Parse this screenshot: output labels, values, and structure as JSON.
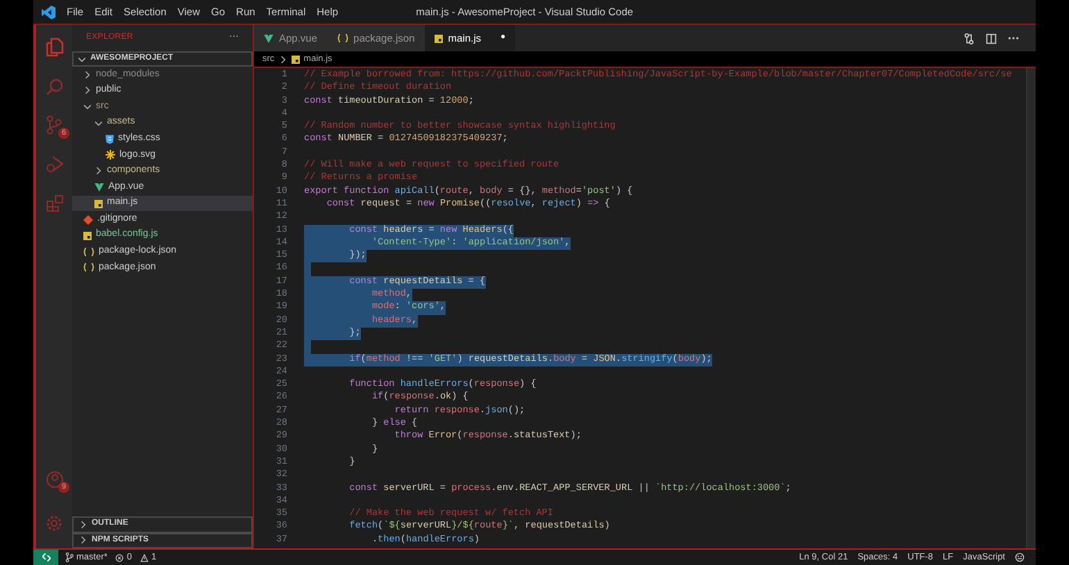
{
  "title_bar": {
    "menu": [
      "File",
      "Edit",
      "Selection",
      "View",
      "Go",
      "Run",
      "Terminal",
      "Help"
    ],
    "title": "main.js - AwesomeProject - Visual Studio Code"
  },
  "activity_bar": {
    "items": [
      {
        "kind": "explorer",
        "selected": true
      },
      {
        "kind": "search",
        "selected": false
      },
      {
        "kind": "source-control",
        "selected": false,
        "badge": "6"
      },
      {
        "kind": "run",
        "selected": false
      },
      {
        "kind": "extensions",
        "selected": false
      }
    ],
    "bottom": [
      {
        "kind": "account",
        "badge": "9"
      },
      {
        "kind": "settings"
      }
    ]
  },
  "sidebar": {
    "title": "EXPLORER",
    "more": "···",
    "project": "AWESOMEPROJECT",
    "tree": [
      {
        "label": "node_modules",
        "kind": "folder",
        "expanded": false,
        "selected": false,
        "color": "#8b8b8b"
      },
      {
        "label": "public",
        "kind": "folder",
        "expanded": false,
        "selected": false,
        "color": "#cccccc"
      },
      {
        "label": "src",
        "kind": "folder",
        "expanded": true,
        "selected": false,
        "color": "#a89a78",
        "children": [
          {
            "label": "assets",
            "kind": "folder",
            "expanded": true,
            "selected": false,
            "color": "#c9b98c",
            "children": [
              {
                "label": "styles.css",
                "kind": "css",
                "selected": false,
                "color": "#cccccc"
              },
              {
                "label": "logo.svg",
                "kind": "svg",
                "selected": false,
                "color": "#cccccc"
              }
            ]
          },
          {
            "label": "components",
            "kind": "folder",
            "expanded": false,
            "selected": false,
            "color": "#c9b98c"
          },
          {
            "label": "App.vue",
            "kind": "vue",
            "selected": false,
            "color": "#cccccc"
          },
          {
            "label": "main.js",
            "kind": "js",
            "selected": true,
            "color": "#cccccc"
          }
        ]
      },
      {
        "label": ".gitignore",
        "kind": "git",
        "selected": false,
        "color": "#cccccc"
      },
      {
        "label": "babel.config.js",
        "kind": "js",
        "selected": false,
        "color": "#73c991"
      },
      {
        "label": "package-lock.json",
        "kind": "json",
        "selected": false,
        "color": "#cccccc"
      },
      {
        "label": "package.json",
        "kind": "json",
        "selected": false,
        "color": "#cccccc"
      }
    ],
    "panels": [
      {
        "label": "OUTLINE",
        "expanded": false
      },
      {
        "label": "NPM SCRIPTS",
        "expanded": false
      }
    ]
  },
  "tabs": [
    {
      "label": "App.vue",
      "kind": "vue",
      "selected": false,
      "modified": false
    },
    {
      "label": "package.json",
      "kind": "json",
      "selected": false,
      "modified": false
    },
    {
      "label": "main.js",
      "kind": "js",
      "selected": true,
      "modified": true,
      "dot": "●"
    }
  ],
  "breadcrumb": [
    {
      "label": "src",
      "kind": "folder"
    },
    {
      "label": "main.js",
      "kind": "js"
    }
  ],
  "code": [
    {
      "number": "1",
      "selected": false,
      "tokens": [
        {
          "text": "// Example borrowed from: https://github.com/PacktPublishing/JavaScript-by-Example/blob/master/Chapter07/CompletedCode/src/se",
          "kind": "comment"
        }
      ]
    },
    {
      "number": "2",
      "selected": false,
      "tokens": [
        {
          "text": "// Define timeout duration",
          "kind": "comment"
        }
      ]
    },
    {
      "number": "3",
      "selected": false,
      "tokens": [
        {
          "text": "const ",
          "kind": "keyword"
        },
        {
          "text": "timeoutDuration",
          "kind": "name"
        },
        {
          "text": " = ",
          "kind": "punct"
        },
        {
          "text": "12000",
          "kind": "number"
        },
        {
          "text": ";",
          "kind": "punct"
        }
      ]
    },
    {
      "number": "4",
      "selected": false
    },
    {
      "number": "5",
      "selected": false,
      "tokens": [
        {
          "text": "// Random number to better showcase syntax highlighting",
          "kind": "comment"
        }
      ]
    },
    {
      "number": "6",
      "selected": false,
      "tokens": [
        {
          "text": "const ",
          "kind": "keyword"
        },
        {
          "text": "NUMBER",
          "kind": "name"
        },
        {
          "text": " = ",
          "kind": "punct"
        },
        {
          "text": "01274509182375409237",
          "kind": "number"
        },
        {
          "text": ";",
          "kind": "punct"
        }
      ]
    },
    {
      "number": "7",
      "selected": false
    },
    {
      "number": "8",
      "selected": false,
      "tokens": [
        {
          "text": "// Will make a web request to specified route",
          "kind": "comment"
        }
      ]
    },
    {
      "number": "9",
      "selected": false,
      "tokens": [
        {
          "text": "// Returns a promise",
          "kind": "comment"
        }
      ]
    },
    {
      "number": "10",
      "selected": false,
      "tokens": [
        {
          "text": "export function ",
          "kind": "keyword"
        },
        {
          "text": "apiCall",
          "kind": "function"
        },
        {
          "text": "(",
          "kind": "punct"
        },
        {
          "text": "route",
          "kind": "param"
        },
        {
          "text": ", ",
          "kind": "punct"
        },
        {
          "text": "body",
          "kind": "param"
        },
        {
          "text": " = {}, ",
          "kind": "punct"
        },
        {
          "text": "method",
          "kind": "param"
        },
        {
          "text": "=",
          "kind": "punct"
        },
        {
          "text": "'post'",
          "kind": "string"
        },
        {
          "text": ") {",
          "kind": "punct"
        }
      ]
    },
    {
      "number": "11",
      "selected": false,
      "tokens": [
        {
          "text": "    const ",
          "kind": "keyword"
        },
        {
          "text": "request",
          "kind": "name"
        },
        {
          "text": " = ",
          "kind": "punct"
        },
        {
          "text": "new ",
          "kind": "keyword"
        },
        {
          "text": "Promise",
          "kind": "type"
        },
        {
          "text": "((",
          "kind": "punct"
        },
        {
          "text": "resolve",
          "kind": "function"
        },
        {
          "text": ", ",
          "kind": "punct"
        },
        {
          "text": "reject",
          "kind": "function"
        },
        {
          "text": ") ",
          "kind": "punct"
        },
        {
          "text": "=> ",
          "kind": "keyword"
        },
        {
          "text": "{",
          "kind": "punct"
        }
      ]
    },
    {
      "number": "12",
      "selected": false
    },
    {
      "number": "13",
      "selected": true,
      "tokens": [
        {
          "text": "        const ",
          "kind": "keyword"
        },
        {
          "text": "headers",
          "kind": "name"
        },
        {
          "text": " = ",
          "kind": "punct"
        },
        {
          "text": "new ",
          "kind": "keyword"
        },
        {
          "text": "Headers",
          "kind": "type"
        },
        {
          "text": "({",
          "kind": "punct"
        }
      ]
    },
    {
      "number": "14",
      "selected": true,
      "tokens": [
        {
          "text": "            'Content-Type'",
          "kind": "string"
        },
        {
          "text": ": ",
          "kind": "punct"
        },
        {
          "text": "'application/json'",
          "kind": "string"
        },
        {
          "text": ",",
          "kind": "punct"
        }
      ]
    },
    {
      "number": "15",
      "selected": true,
      "tokens": [
        {
          "text": "        });",
          "kind": "punct"
        }
      ]
    },
    {
      "number": "16",
      "selected": true
    },
    {
      "number": "17",
      "selected": true,
      "tokens": [
        {
          "text": "        const ",
          "kind": "keyword"
        },
        {
          "text": "requestDetails",
          "kind": "name"
        },
        {
          "text": " = {",
          "kind": "punct"
        }
      ]
    },
    {
      "number": "18",
      "selected": true,
      "tokens": [
        {
          "text": "            method",
          "kind": "param"
        },
        {
          "text": ",",
          "kind": "punct"
        }
      ]
    },
    {
      "number": "19",
      "selected": true,
      "tokens": [
        {
          "text": "            mode",
          "kind": "param"
        },
        {
          "text": ": ",
          "kind": "punct"
        },
        {
          "text": "'cors'",
          "kind": "string"
        },
        {
          "text": ",",
          "kind": "punct"
        }
      ]
    },
    {
      "number": "20",
      "selected": true,
      "tokens": [
        {
          "text": "            headers",
          "kind": "param"
        },
        {
          "text": ",",
          "kind": "punct"
        }
      ]
    },
    {
      "number": "21",
      "selected": true,
      "tokens": [
        {
          "text": "        };",
          "kind": "punct"
        }
      ]
    },
    {
      "number": "22",
      "selected": true
    },
    {
      "number": "23",
      "selected": true,
      "tokens": [
        {
          "text": "        if",
          "kind": "keyword"
        },
        {
          "text": "(",
          "kind": "punct"
        },
        {
          "text": "method",
          "kind": "param"
        },
        {
          "text": " !== ",
          "kind": "punct"
        },
        {
          "text": "'GET'",
          "kind": "string"
        },
        {
          "text": ") ",
          "kind": "punct"
        },
        {
          "text": "requestDetails",
          "kind": "name"
        },
        {
          "text": ".",
          "kind": "punct"
        },
        {
          "text": "body",
          "kind": "param"
        },
        {
          "text": " = ",
          "kind": "punct"
        },
        {
          "text": "JSON",
          "kind": "type"
        },
        {
          "text": ".",
          "kind": "punct"
        },
        {
          "text": "stringify",
          "kind": "function"
        },
        {
          "text": "(",
          "kind": "punct"
        },
        {
          "text": "body",
          "kind": "param"
        },
        {
          "text": ");",
          "kind": "punct"
        }
      ]
    },
    {
      "number": "24",
      "selected": false
    },
    {
      "number": "25",
      "selected": false,
      "tokens": [
        {
          "text": "        function ",
          "kind": "keyword"
        },
        {
          "text": "handleErrors",
          "kind": "function"
        },
        {
          "text": "(",
          "kind": "punct"
        },
        {
          "text": "response",
          "kind": "param"
        },
        {
          "text": ") {",
          "kind": "punct"
        }
      ]
    },
    {
      "number": "26",
      "selected": false,
      "tokens": [
        {
          "text": "            if",
          "kind": "keyword"
        },
        {
          "text": "(",
          "kind": "punct"
        },
        {
          "text": "response",
          "kind": "param"
        },
        {
          "text": ".",
          "kind": "punct"
        },
        {
          "text": "ok",
          "kind": "name"
        },
        {
          "text": ") {",
          "kind": "punct"
        }
      ]
    },
    {
      "number": "27",
      "selected": false,
      "tokens": [
        {
          "text": "                return ",
          "kind": "keyword"
        },
        {
          "text": "response",
          "kind": "param"
        },
        {
          "text": ".",
          "kind": "punct"
        },
        {
          "text": "json",
          "kind": "function"
        },
        {
          "text": "();",
          "kind": "punct"
        }
      ]
    },
    {
      "number": "28",
      "selected": false,
      "tokens": [
        {
          "text": "            } ",
          "kind": "punct"
        },
        {
          "text": "else ",
          "kind": "keyword"
        },
        {
          "text": "{",
          "kind": "punct"
        }
      ]
    },
    {
      "number": "29",
      "selected": false,
      "tokens": [
        {
          "text": "                throw ",
          "kind": "keyword"
        },
        {
          "text": "Error",
          "kind": "type"
        },
        {
          "text": "(",
          "kind": "punct"
        },
        {
          "text": "response",
          "kind": "param"
        },
        {
          "text": ".",
          "kind": "punct"
        },
        {
          "text": "statusText",
          "kind": "name"
        },
        {
          "text": ");",
          "kind": "punct"
        }
      ]
    },
    {
      "number": "30",
      "selected": false,
      "tokens": [
        {
          "text": "            }",
          "kind": "punct"
        }
      ]
    },
    {
      "number": "31",
      "selected": false,
      "tokens": [
        {
          "text": "        }",
          "kind": "punct"
        }
      ]
    },
    {
      "number": "32",
      "selected": false
    },
    {
      "number": "33",
      "selected": false,
      "tokens": [
        {
          "text": "        const ",
          "kind": "keyword"
        },
        {
          "text": "serverURL",
          "kind": "name"
        },
        {
          "text": " = ",
          "kind": "punct"
        },
        {
          "text": "process",
          "kind": "param"
        },
        {
          "text": ".",
          "kind": "punct"
        },
        {
          "text": "env",
          "kind": "name"
        },
        {
          "text": ".",
          "kind": "punct"
        },
        {
          "text": "REACT_APP_SERVER_URL",
          "kind": "name"
        },
        {
          "text": " || ",
          "kind": "punct"
        },
        {
          "text": "`http://localhost:3000`",
          "kind": "string"
        },
        {
          "text": ";",
          "kind": "punct"
        }
      ]
    },
    {
      "number": "34",
      "selected": false
    },
    {
      "number": "35",
      "selected": false,
      "tokens": [
        {
          "text": "        // Make the web request w/ fetch API",
          "kind": "comment"
        }
      ]
    },
    {
      "number": "36",
      "selected": false,
      "tokens": [
        {
          "text": "        fetch",
          "kind": "function"
        },
        {
          "text": "(",
          "kind": "punct"
        },
        {
          "text": "`${",
          "kind": "string"
        },
        {
          "text": "serverURL",
          "kind": "name"
        },
        {
          "text": "}/${",
          "kind": "string"
        },
        {
          "text": "route",
          "kind": "param"
        },
        {
          "text": "}`",
          "kind": "string"
        },
        {
          "text": ", ",
          "kind": "punct"
        },
        {
          "text": "requestDetails",
          "kind": "name"
        },
        {
          "text": ")",
          "kind": "punct"
        }
      ]
    },
    {
      "number": "37",
      "selected": false,
      "tokens": [
        {
          "text": "            .",
          "kind": "punct"
        },
        {
          "text": "then",
          "kind": "function"
        },
        {
          "text": "(",
          "kind": "punct"
        },
        {
          "text": "handleErrors",
          "kind": "function"
        },
        {
          "text": ")",
          "kind": "punct"
        }
      ]
    }
  ],
  "status_bar": {
    "branch": "master*",
    "errors": "0",
    "warnings": "1",
    "right": [
      "Ln 9, Col 21",
      "Spaces: 4",
      "UTF-8",
      "LF",
      "JavaScript"
    ]
  }
}
